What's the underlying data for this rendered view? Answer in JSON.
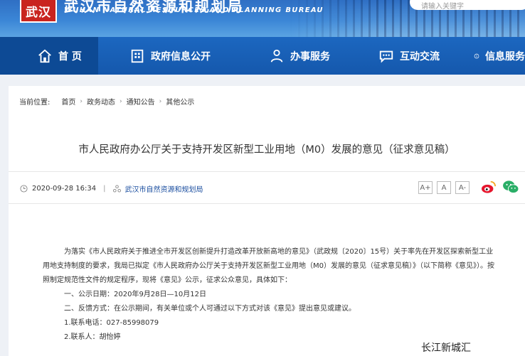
{
  "header": {
    "logo_text": "武汉",
    "site_title": "武汉市自然资源和规划局",
    "site_subtitle": "WUHAN NATURAL RESOURCES AND PLANNING BUREAU",
    "search_placeholder": "请输入关键字"
  },
  "nav": {
    "home": "首 页",
    "gov_info": "政府信息公开",
    "services": "办事服务",
    "interaction": "互动交流",
    "info_service": "信息服务"
  },
  "breadcrumb": {
    "label": "当前位置:",
    "items": [
      "首页",
      "政务动态",
      "通知公告",
      "其他公示"
    ]
  },
  "article": {
    "title": "市人民政府办公厅关于支持开发区新型工业用地（M0）发展的意见（征求意见稿）",
    "date": "2020-09-28 16:34",
    "divider": "|",
    "source": "武汉市自然资源和规划局",
    "font_sizes": [
      "A+",
      "A",
      "A-"
    ],
    "paragraphs": [
      "为落实《市人民政府关于推进全市开发区创新提升打造改革开放新高地的意见》（武政规〔2020〕15号）关于率先在开发区探索新型工业用地支持制度的要求，我局已拟定《市人民政府办公厅关于支持开发区新型工业用地（M0）发展的意见（征求意见稿）》（以下简称《意见》）。按照制定规范性文件的规定程序，现将《意见》公示，征求公众意见，具体如下：",
      "一、公示日期：2020年9月28日—10月12日",
      "二、反馈方式：在公示期间，有关单位或个人可通过以下方式对该《意见》提出意见或建议。",
      "1.联系电话：027-85998079",
      "2.联系人：胡怡婷"
    ]
  },
  "watermark": "长江新城汇",
  "colors": {
    "nav_bg": "#1558ac",
    "nav_active": "#0d4a95",
    "logo_red": "#c9241f",
    "weibo": "#e6162d",
    "wechat": "#2aae67"
  }
}
